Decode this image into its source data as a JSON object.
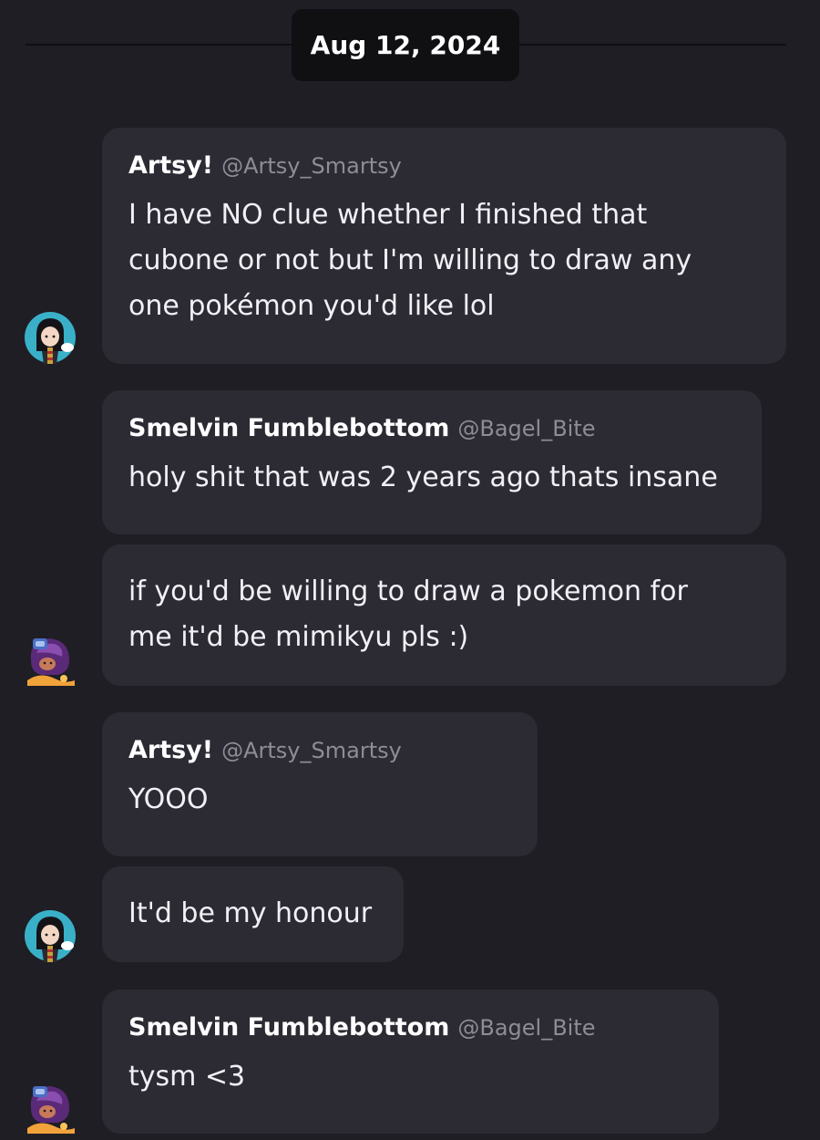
{
  "date_divider": "Aug 12, 2024",
  "messages": [
    {
      "name": "Artsy!",
      "handle": "@Artsy_Smartsy",
      "lines": [
        "I have NO clue whether I finished that",
        "cubone or not but I'm willing to draw any",
        "one pokémon you'd like lol"
      ]
    },
    {
      "name": "Smelvin Fumblebottom",
      "handle": "@Bagel_Bite",
      "lines": [
        "holy shit that was 2 years ago thats insane"
      ]
    },
    {
      "lines": [
        "if you'd be willing to draw a pokemon for",
        "me it'd be mimikyu pls :)"
      ]
    },
    {
      "name": "Artsy!",
      "handle": "@Artsy_Smartsy",
      "lines": [
        "YOOO"
      ]
    },
    {
      "lines": [
        "It'd be my honour"
      ]
    },
    {
      "name": "Smelvin Fumblebottom",
      "handle": "@Bagel_Bite",
      "lines": [
        "tysm <3"
      ]
    }
  ],
  "icons": {
    "artsy_avatar": "artsy-avatar-icon",
    "smelvin_avatar": "smelvin-avatar-icon"
  },
  "colors": {
    "background": "#1f1e25",
    "bubble": "#2c2a33",
    "date_pill": "#101013",
    "handle": "#8e8c95",
    "artsy_avatar_bg": "#3ab0c8",
    "smelvin_avatar_accent": "#f2a23a"
  }
}
